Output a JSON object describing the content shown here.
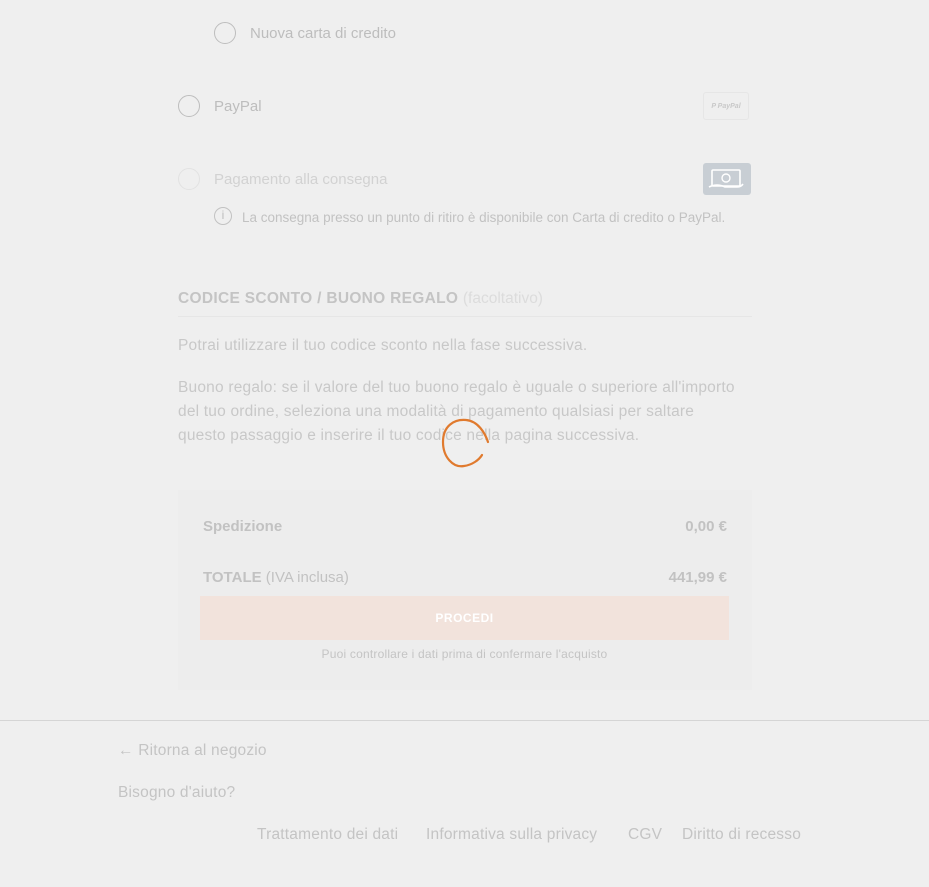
{
  "payment_options": {
    "new_card_label": "Nuova carta di credito",
    "paypal_label": "PayPal",
    "paypal_badge_text": "P PayPal",
    "cod_label": "Pagamento alla consegna",
    "cod_info": "La consegna presso un punto di ritiro è disponibile con Carta di credito o PayPal."
  },
  "discount": {
    "title": "CODICE SCONTO / BUONO REGALO",
    "optional": "(facoltativo)",
    "note": "Potrai utilizzare il tuo codice sconto nella fase successiva.",
    "gift_note": "Buono regalo: se il valore del tuo buono regalo è uguale o superiore all'importo del tuo ordine, seleziona una modalità di pagamento qualsiasi per saltare questo passaggio e inserire il tuo codice nella pagina successiva."
  },
  "summary": {
    "shipping_label": "Spedizione",
    "shipping_value": "0,00 €",
    "total_label": "TOTALE",
    "total_suffix": "(IVA inclusa)",
    "total_value": "441,99 €",
    "proceed_label": "PROCEDI",
    "hint": "Puoi controllare i dati prima di confermare l'acquisto"
  },
  "footer": {
    "back_label": "← Ritorna al negozio",
    "help_label": "Bisogno d'aiuto?",
    "links": [
      "Trattamento dei dati",
      "Informativa sulla privacy",
      "CGV",
      "Diritto di recesso"
    ]
  },
  "colors": {
    "accent": "#e07a2e",
    "proceed_bg": "#f2e3dc"
  },
  "icons": [
    "radio-icon",
    "paypal-logo-icon",
    "cash-icon",
    "info-icon",
    "arrow-left-icon",
    "loading-spinner-icon"
  ]
}
